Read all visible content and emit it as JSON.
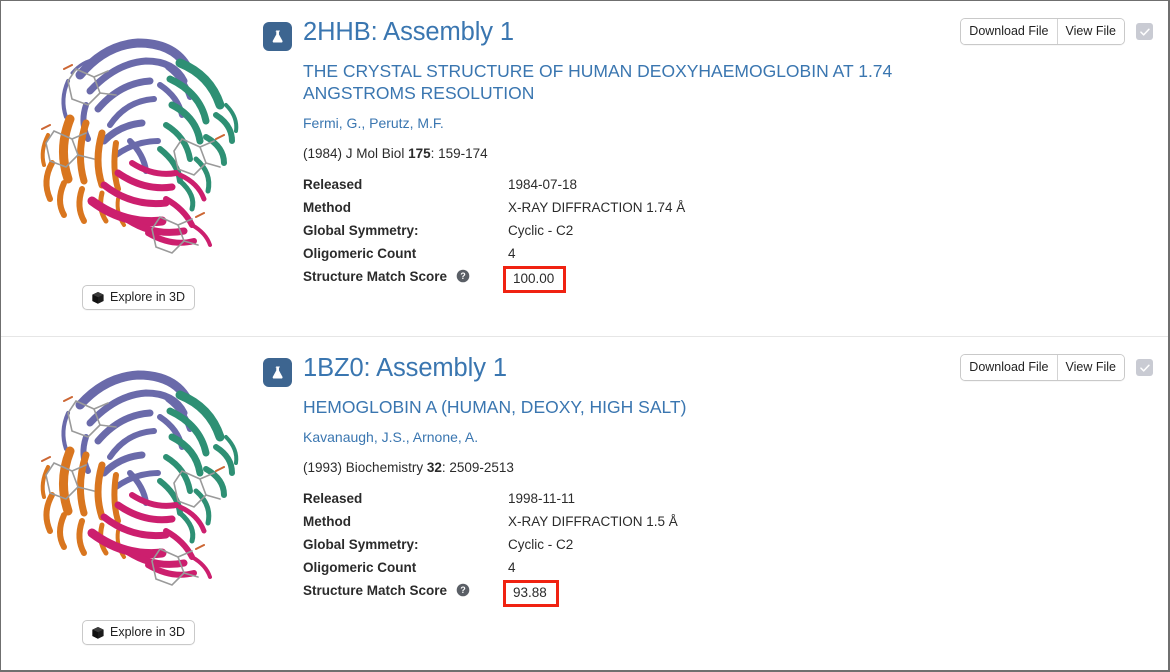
{
  "results": [
    {
      "icon": "flask-icon",
      "title": "2HHB: Assembly 1",
      "subtitle": "THE CRYSTAL STRUCTURE OF HUMAN DEOXYHAEMOGLOBIN AT 1.74 ANGSTROMS RESOLUTION",
      "authors": "Fermi, G., Perutz, M.F.",
      "citation_year": "(1984)",
      "citation_journal": "J Mol Biol",
      "citation_volume": "175",
      "citation_pages": ": 159-174",
      "meta": [
        {
          "label": "Released",
          "value": "1984-07-18"
        },
        {
          "label": "Method",
          "value": "X-RAY DIFFRACTION 1.74 Å"
        },
        {
          "label": "Global Symmetry:",
          "value": "Cyclic - C2"
        },
        {
          "label": "Oligomeric Count",
          "value": "4"
        }
      ],
      "score_label": "Structure Match Score",
      "score_value": "100.00",
      "explore_label": "Explore in 3D",
      "download_label": "Download File",
      "view_label": "View File",
      "checkbox_checked": true
    },
    {
      "icon": "flask-icon",
      "title": "1BZ0: Assembly 1",
      "subtitle": "HEMOGLOBIN A (HUMAN, DEOXY, HIGH SALT)",
      "authors": "Kavanaugh, J.S., Arnone, A.",
      "citation_year": "(1993)",
      "citation_journal": "Biochemistry",
      "citation_volume": "32",
      "citation_pages": ": 2509-2513",
      "meta": [
        {
          "label": "Released",
          "value": "1998-11-11"
        },
        {
          "label": "Method",
          "value": "X-RAY DIFFRACTION 1.5 Å"
        },
        {
          "label": "Global Symmetry:",
          "value": "Cyclic - C2"
        },
        {
          "label": "Oligomeric Count",
          "value": "4"
        }
      ],
      "score_label": "Structure Match Score",
      "score_value": "93.88",
      "explore_label": "Explore in 3D",
      "download_label": "Download File",
      "view_label": "View File",
      "checkbox_checked": true
    }
  ],
  "colors": {
    "link": "#3a76b0",
    "flask_bg": "#3d6590",
    "score_highlight": "#f02211",
    "chain_purple": "#6a6aaa",
    "chain_green": "#2e9074",
    "chain_orange": "#d9761f",
    "chain_magenta": "#cc1f6e"
  }
}
